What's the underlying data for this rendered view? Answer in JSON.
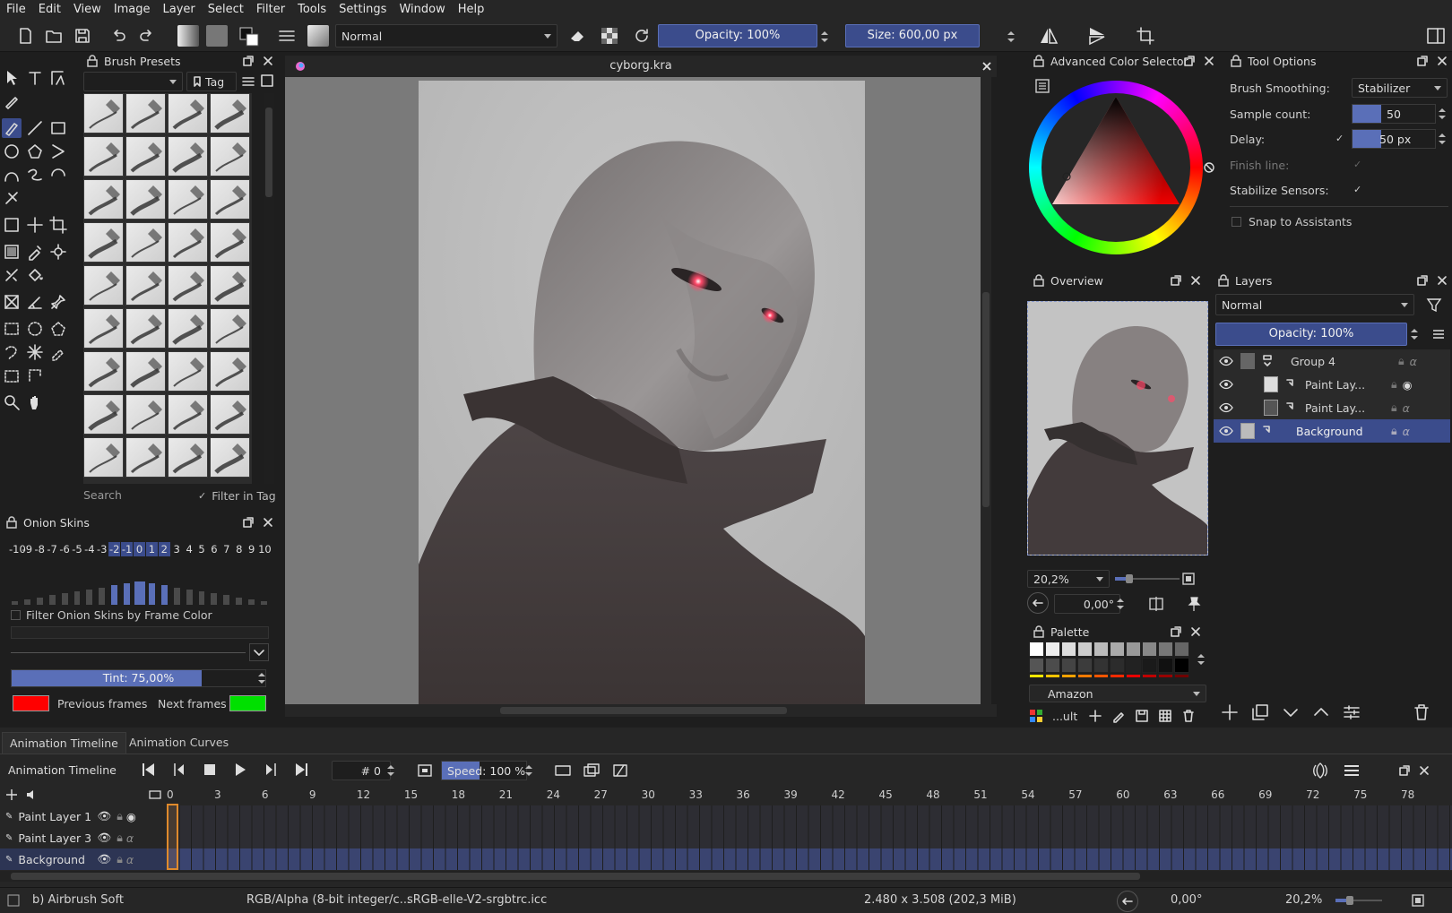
{
  "menubar": [
    "File",
    "Edit",
    "View",
    "Image",
    "Layer",
    "Select",
    "Filter",
    "Tools",
    "Settings",
    "Window",
    "Help"
  ],
  "toolbar": {
    "blend_mode": "Normal",
    "opacity": "Opacity: 100%",
    "size": "Size: 600,00 px"
  },
  "document": {
    "tab_title": "cyborg.kra"
  },
  "brush_presets": {
    "title": "Brush Presets",
    "tag_label": "Tag",
    "search_placeholder": "Search",
    "filter_in_tag": "Filter in Tag"
  },
  "onion_skins": {
    "title": "Onion Skins",
    "frame_labels": [
      "-10",
      "-9",
      "-8",
      "-7",
      "-6",
      "-5",
      "-4",
      "-3",
      "-2",
      "-1",
      "0",
      "1",
      "2",
      "3",
      "4",
      "5",
      "6",
      "7",
      "8",
      "9",
      "10"
    ],
    "filter_label": "Filter Onion Skins by Frame Color",
    "tint": "Tint: 75,00%",
    "previous_label": "Previous frames",
    "next_label": "Next frames",
    "previous_color": "#ff0000",
    "next_color": "#00e000"
  },
  "color_selector": {
    "title": "Advanced Color Selector"
  },
  "tool_options": {
    "title": "Tool Options",
    "smoothing_label": "Brush Smoothing:",
    "smoothing_value": "Stabilizer",
    "sample_label": "Sample count:",
    "sample_value": "50",
    "delay_label": "Delay:",
    "delay_value": "50 px",
    "finish_label": "Finish line:",
    "stabilize_label": "Stabilize Sensors:",
    "snap_label": "Snap to Assistants"
  },
  "overview": {
    "title": "Overview",
    "zoom": "20,2%",
    "rotation": "0,00°"
  },
  "layers": {
    "title": "Layers",
    "blend_mode": "Normal",
    "opacity": "Opacity:  100%",
    "items": [
      {
        "name": "Group 4"
      },
      {
        "name": "Paint Lay..."
      },
      {
        "name": "Paint Lay..."
      },
      {
        "name": "Background"
      }
    ]
  },
  "palette": {
    "title": "Palette",
    "name": "Amazon",
    "footer_label": "...ult"
  },
  "timeline": {
    "tabs": [
      "Animation Timeline",
      "Animation Curves"
    ],
    "title": "Animation Timeline",
    "frame": "# 0",
    "speed": "Speed: 100 %",
    "frame_numbers": [
      "0",
      "3",
      "6",
      "9",
      "12",
      "15",
      "18",
      "21",
      "24",
      "27",
      "30",
      "33",
      "36",
      "39",
      "42",
      "45",
      "48",
      "51",
      "54",
      "57",
      "60",
      "63",
      "66",
      "69",
      "72",
      "75",
      "78"
    ],
    "layers": [
      "Paint Layer 1",
      "Paint Layer 3",
      "Background"
    ]
  },
  "status": {
    "brush": "b) Airbrush Soft",
    "color_model": "RGB/Alpha (8-bit integer/c...",
    "profile": "sRGB-elle-V2-srgbtrc.icc",
    "size": "2.480 x 3.508 (202,3 MiB)",
    "rotation": "0,00°",
    "zoom": "20,2%"
  }
}
